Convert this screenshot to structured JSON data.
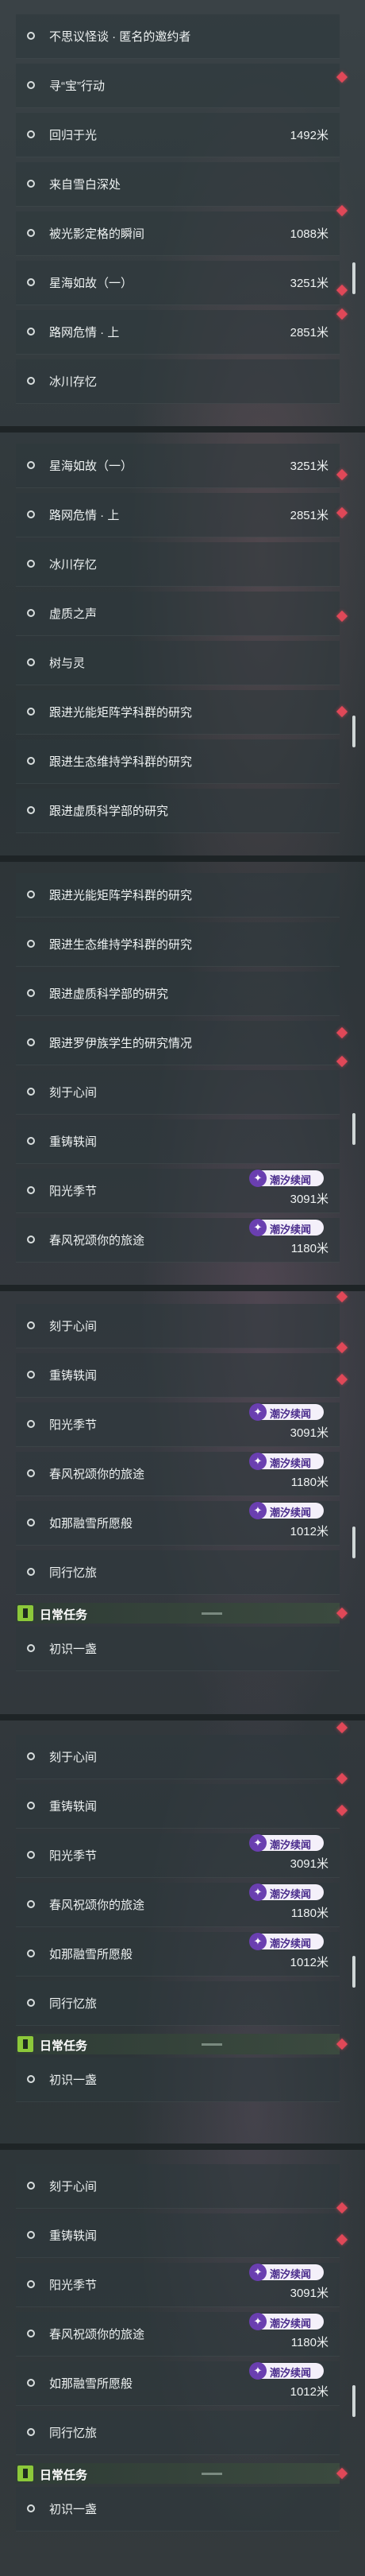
{
  "badge_text": "潮汐续闻",
  "daily_title": "日常任务",
  "sections": [
    {
      "rows": [
        {
          "label": "不思议怪谈 · 匿名的邀约者"
        },
        {
          "label": "寻“宝”行动"
        },
        {
          "label": "回归于光",
          "distance": "1492米"
        },
        {
          "label": "来自雪白深处"
        },
        {
          "label": "被光影定格的瞬间",
          "distance": "1088米"
        },
        {
          "label": "星海如故（一）",
          "distance": "3251米"
        },
        {
          "label": "路网危情 · 上",
          "distance": "2851米"
        },
        {
          "label": "冰川存忆"
        }
      ]
    },
    {
      "rows": [
        {
          "label": "星海如故（一）",
          "distance": "3251米"
        },
        {
          "label": "路网危情 · 上",
          "distance": "2851米"
        },
        {
          "label": "冰川存忆"
        },
        {
          "label": "虚质之声"
        },
        {
          "label": "树与灵"
        },
        {
          "label": "跟进光能矩阵学科群的研究"
        },
        {
          "label": "跟进生态维持学科群的研究"
        },
        {
          "label": "跟进虚质科学部的研究"
        }
      ]
    },
    {
      "rows": [
        {
          "label": "跟进光能矩阵学科群的研究"
        },
        {
          "label": "跟进生态维持学科群的研究"
        },
        {
          "label": "跟进虚质科学部的研究"
        },
        {
          "label": "跟进罗伊族学生的研究情况"
        },
        {
          "label": "刻于心间"
        },
        {
          "label": "重铸轶闻"
        },
        {
          "label": "阳光季节",
          "distance": "3091米"
        },
        {
          "label": "春风祝颂你的旅途",
          "distance": "1180米"
        }
      ]
    },
    {
      "rows": [
        {
          "label": "刻于心间"
        },
        {
          "label": "重铸轶闻"
        },
        {
          "label": "阳光季节",
          "distance": "3091米"
        },
        {
          "label": "春风祝颂你的旅途",
          "distance": "1180米"
        },
        {
          "label": "如那融雪所愿般",
          "distance": "1012米"
        },
        {
          "label": "同行忆旅"
        }
      ],
      "daily": [
        {
          "label": "初识一盏"
        }
      ]
    },
    {
      "rows": [
        {
          "label": "刻于心间"
        },
        {
          "label": "重铸轶闻"
        },
        {
          "label": "阳光季节",
          "distance": "3091米"
        },
        {
          "label": "春风祝颂你的旅途",
          "distance": "1180米"
        },
        {
          "label": "如那融雪所愿般",
          "distance": "1012米"
        },
        {
          "label": "同行忆旅"
        }
      ],
      "daily": [
        {
          "label": "初识一盏"
        }
      ]
    },
    {
      "rows": [
        {
          "label": "刻于心间"
        },
        {
          "label": "重铸轶闻"
        },
        {
          "label": "阳光季节",
          "distance": "3091米"
        },
        {
          "label": "春风祝颂你的旅途",
          "distance": "1180米"
        },
        {
          "label": "如那融雪所愿般",
          "distance": "1012米"
        },
        {
          "label": "同行忆旅"
        }
      ],
      "daily": [
        {
          "label": "初识一盏"
        }
      ]
    }
  ]
}
